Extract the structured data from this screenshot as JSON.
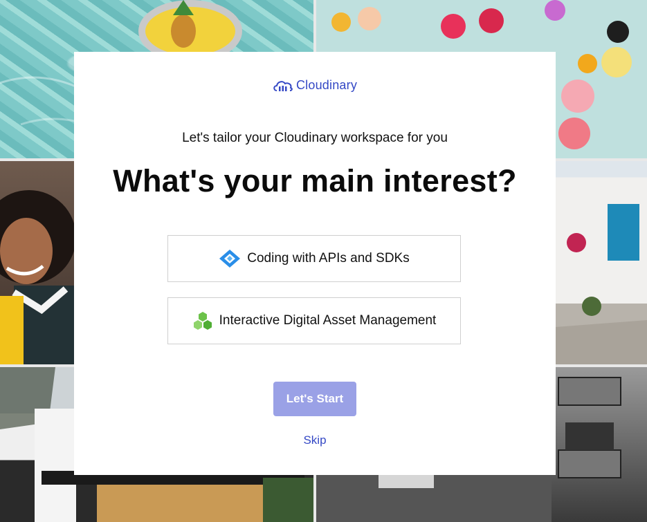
{
  "brand": {
    "name": "Cloudinary",
    "color": "#3448c5"
  },
  "modal": {
    "subtitle": "Let's tailor your Cloudinary workspace for you",
    "title": "What's your main interest?",
    "options": [
      {
        "label": "Coding with APIs and SDKs",
        "icon": "diamond-code-icon"
      },
      {
        "label": "Interactive Digital Asset Management",
        "icon": "hexagon-cluster-icon"
      }
    ],
    "start_label": "Let's Start",
    "skip_label": "Skip"
  },
  "background_images": [
    "pool-image",
    "flowers-image",
    "woman-image",
    "white-house-image",
    "modern-house-image",
    "balcony-bw-image"
  ]
}
